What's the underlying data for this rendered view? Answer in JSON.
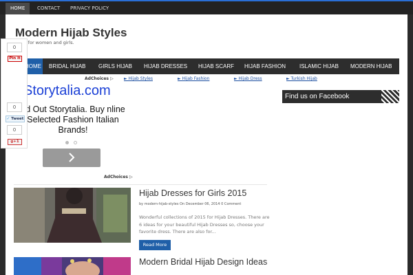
{
  "topbar": {
    "items": [
      "HOME",
      "CONTACT",
      "PRIVACY POLICY"
    ]
  },
  "site": {
    "title": "Modern Hijab Styles",
    "tagline": "Hijab for women and girls."
  },
  "nav": {
    "items": [
      "HOME",
      "BRIDAL HIJAB",
      "GIRLS HIJAB",
      "HIJAB DRESSES",
      "HIJAB SCARF",
      "HIJAB FASHION",
      "ISLAMIC HIJAB",
      "MODERN HIJAB"
    ]
  },
  "adlinks": {
    "adchoices": "AdChoices ▷",
    "links": [
      "► Hijab Styles",
      "► Hijab Fashion",
      "► Hijab Dress",
      "► Turkish Hijab"
    ]
  },
  "ad": {
    "title": "Storytalia.com",
    "text": "nd Out Storytalia. Buy nline Selected Fashion Italian Brands!",
    "button_icon": "chevron-right-icon",
    "adchoices": "AdChoices ▷"
  },
  "share": {
    "pin_count": "0",
    "pin_label": "Pin it",
    "tweet_count": "0",
    "tweet_label": "Tweet",
    "gplus_count": "0",
    "gplus_label": "g+1"
  },
  "sidebar": {
    "facebook_heading": "Find us on Facebook"
  },
  "posts": [
    {
      "title": "Hijab Dresses for Girls 2015",
      "meta": "by modern-hijab-styles On December 06, 2014 0 Comment",
      "excerpt": "Wonderful collections of 2015 for Hijab Dresses. There are 6 ideas for your beautiful Hijab Dresses so, choose your favorite dress. There are also for...",
      "read_more": "Read More"
    },
    {
      "title": "Modern Bridal Hijab Design Ideas"
    }
  ],
  "colors": {
    "accent": "#1f5fa8",
    "nav_bg": "#2d2d2d",
    "ad_link": "#1a3fd6"
  }
}
